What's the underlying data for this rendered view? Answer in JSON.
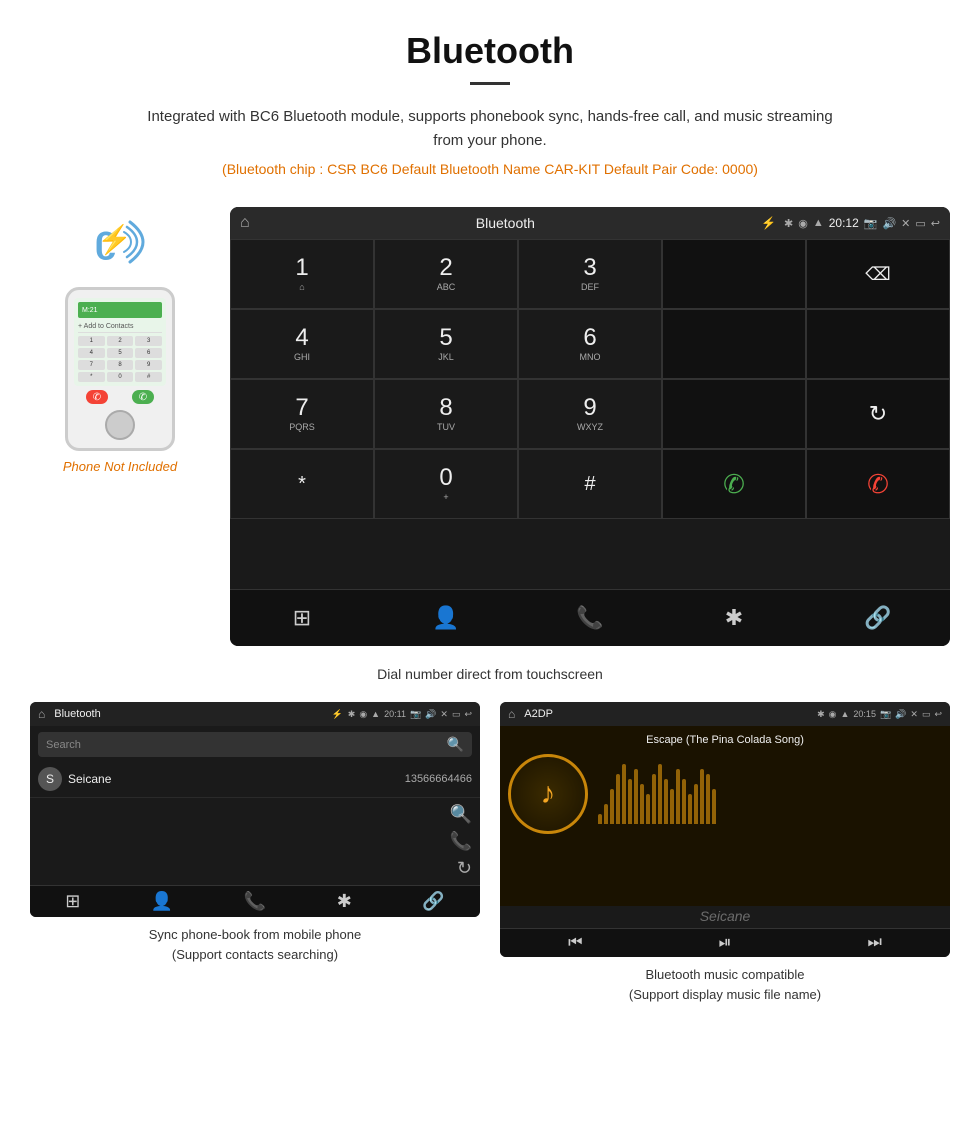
{
  "header": {
    "title": "Bluetooth",
    "description": "Integrated with BC6 Bluetooth module, supports phonebook sync, hands-free call, and music streaming from your phone.",
    "specs": "(Bluetooth chip : CSR BC6   Default Bluetooth Name CAR-KIT    Default Pair Code: 0000)"
  },
  "phone_note": "Phone Not Included",
  "dial_screen": {
    "title": "Bluetooth",
    "time": "20:12",
    "keys": [
      {
        "main": "1",
        "sub": "⌂"
      },
      {
        "main": "2",
        "sub": "ABC"
      },
      {
        "main": "3",
        "sub": "DEF"
      },
      {
        "main": "",
        "sub": ""
      },
      {
        "main": "⌫",
        "sub": ""
      },
      {
        "main": "4",
        "sub": "GHI"
      },
      {
        "main": "5",
        "sub": "JKL"
      },
      {
        "main": "6",
        "sub": "MNO"
      },
      {
        "main": "",
        "sub": ""
      },
      {
        "main": "",
        "sub": ""
      },
      {
        "main": "7",
        "sub": "PQRS"
      },
      {
        "main": "8",
        "sub": "TUV"
      },
      {
        "main": "9",
        "sub": "WXYZ"
      },
      {
        "main": "",
        "sub": ""
      },
      {
        "main": "↻",
        "sub": ""
      },
      {
        "main": "*",
        "sub": ""
      },
      {
        "main": "0",
        "sub": "+"
      },
      {
        "main": "#",
        "sub": ""
      },
      {
        "main": "📞",
        "sub": ""
      },
      {
        "main": "📞",
        "sub": "red"
      }
    ],
    "nav_items": [
      "⊞",
      "👤",
      "📞",
      "✱",
      "🔗"
    ],
    "caption": "Dial number direct from touchscreen"
  },
  "phonebook_screen": {
    "title": "Bluetooth",
    "time": "20:11",
    "search_placeholder": "Search",
    "contacts": [
      {
        "letter": "S",
        "name": "Seicane",
        "number": "13566664466"
      }
    ],
    "nav_items": [
      "⊞",
      "👤",
      "📞",
      "✱",
      "🔗"
    ],
    "caption_line1": "Sync phone-book from mobile phone",
    "caption_line2": "(Support contacts searching)"
  },
  "music_screen": {
    "title": "A2DP",
    "time": "20:15",
    "song_title": "Escape (The Pina Colada Song)",
    "nav_items": [
      "⏮",
      "⏯",
      "⏭"
    ],
    "caption_line1": "Bluetooth music compatible",
    "caption_line2": "(Support display music file name)"
  },
  "music_bars": [
    10,
    20,
    35,
    50,
    60,
    45,
    55,
    40,
    30,
    50,
    60,
    45,
    35,
    55,
    45,
    30,
    40,
    55,
    50,
    35
  ],
  "colors": {
    "accent_orange": "#e07000",
    "screen_bg": "#1a1a1a",
    "screen_dark": "#111",
    "key_border": "#333"
  }
}
